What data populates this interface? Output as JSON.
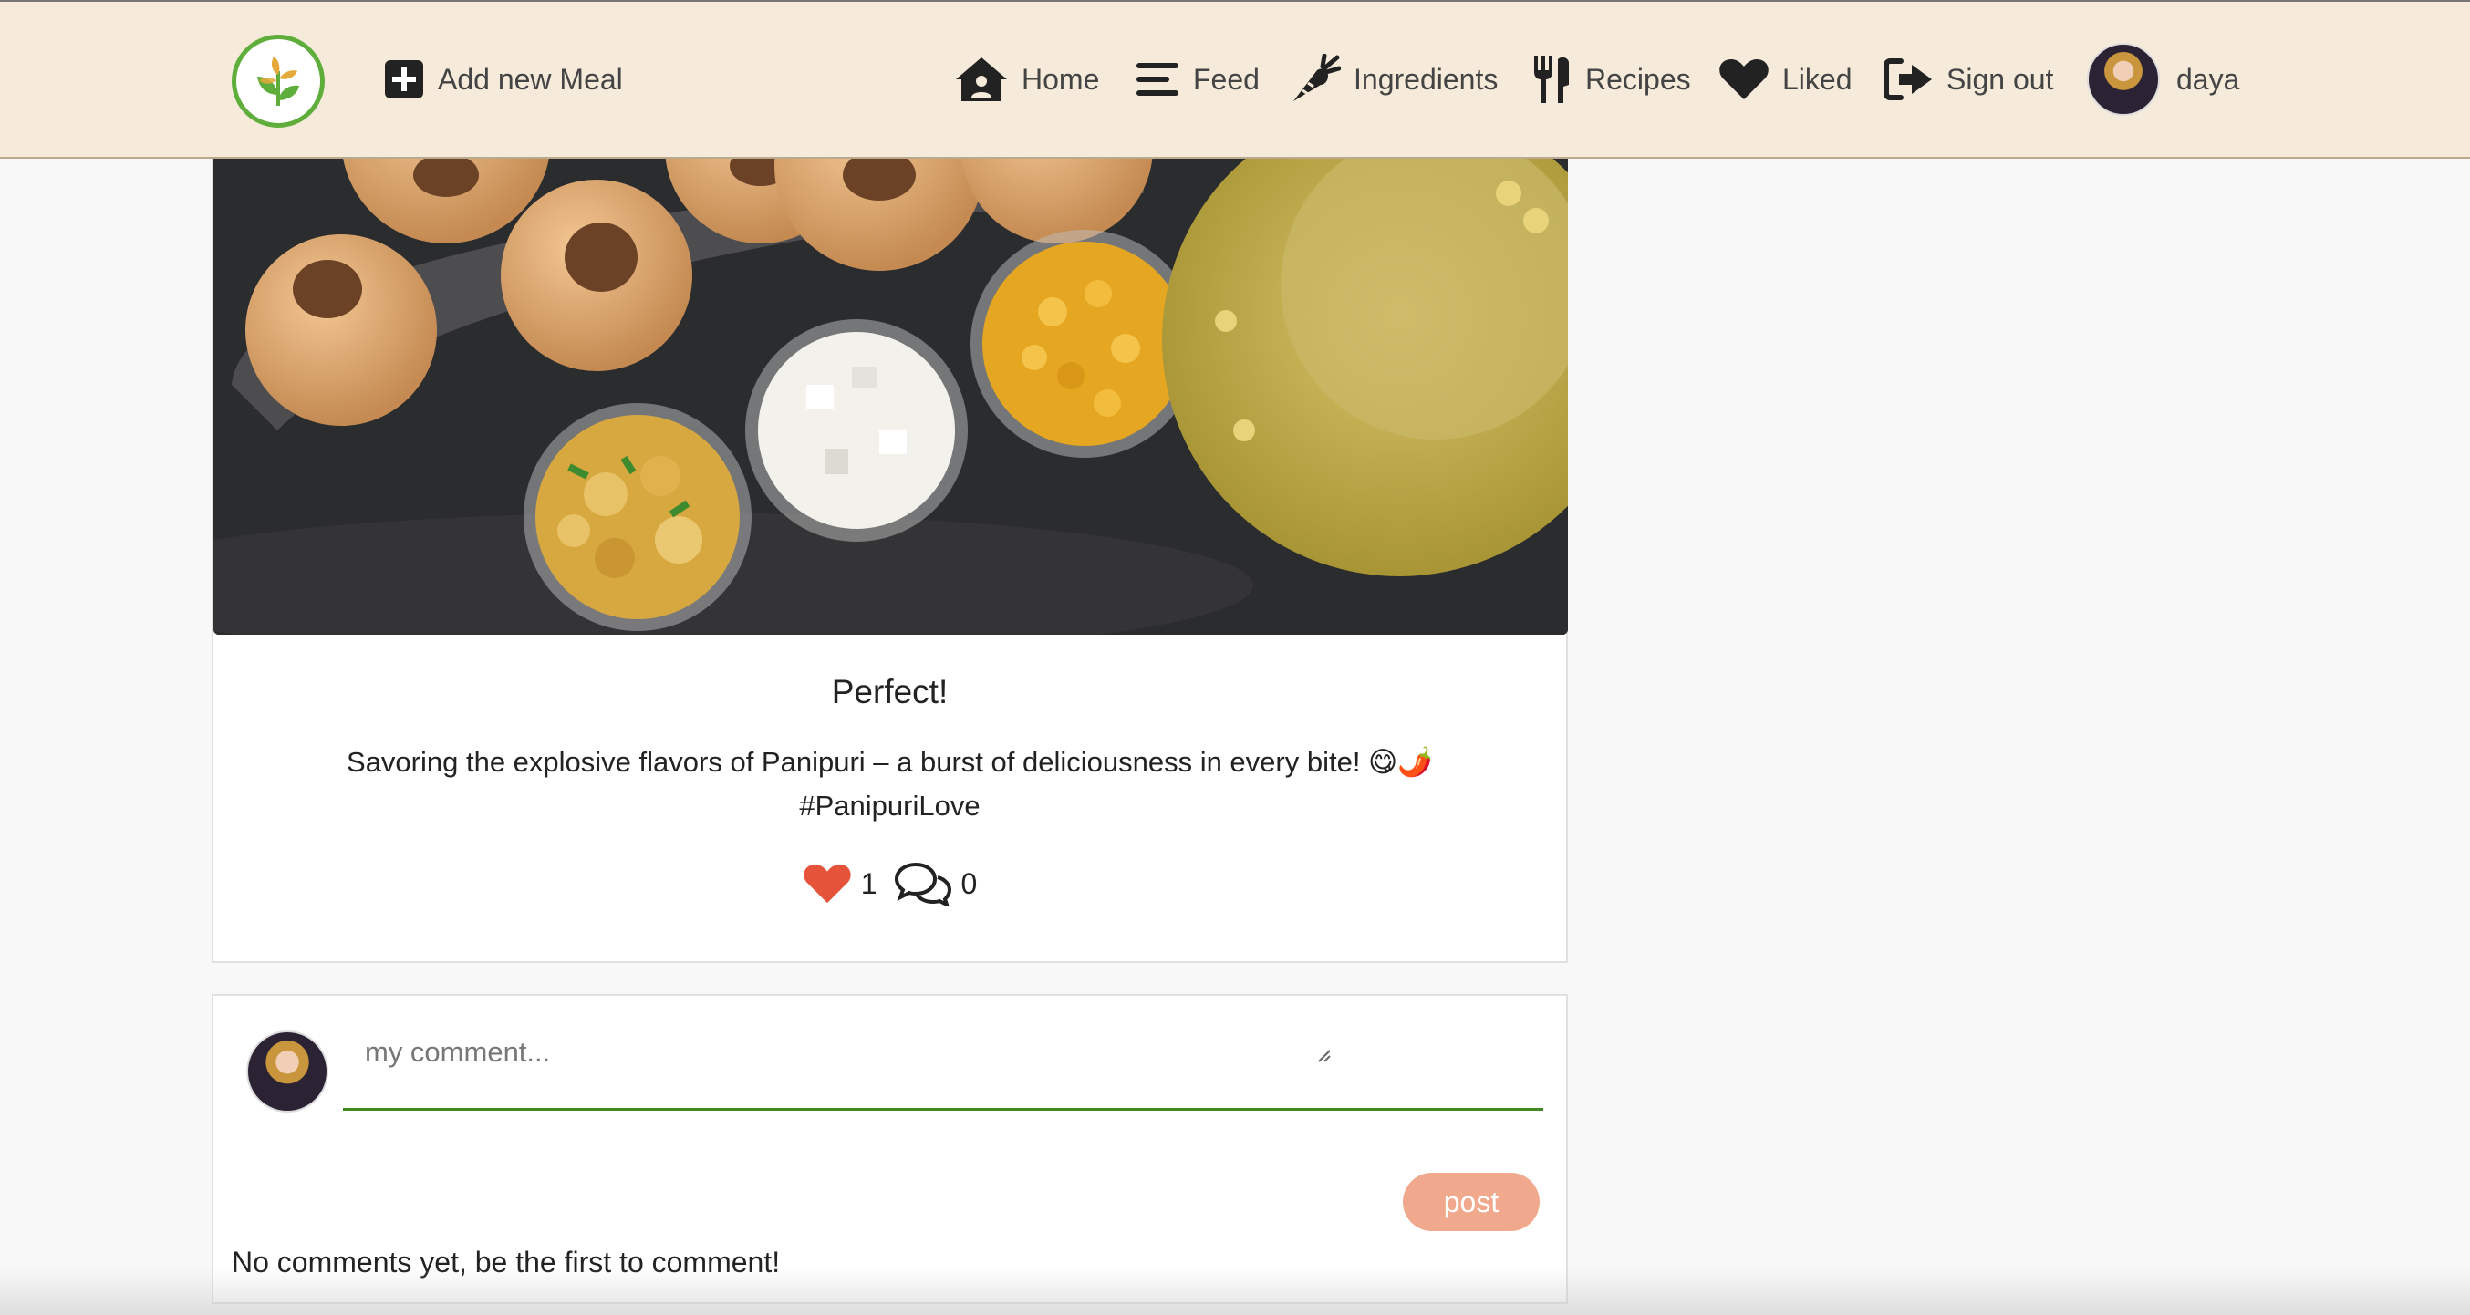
{
  "navbar": {
    "add_meal_label": "Add new Meal",
    "home_label": "Home",
    "feed_label": "Feed",
    "ingredients_label": "Ingredients",
    "recipes_label": "Recipes",
    "liked_label": "Liked",
    "signout_label": "Sign out",
    "username": "daya"
  },
  "post": {
    "title": "Perfect!",
    "description": "Savoring the explosive flavors of Panipuri – a burst of deliciousness in every bite! 😋🌶️",
    "hashtag": "#PanipuriLove",
    "likes": "1",
    "comments": "0"
  },
  "comment_box": {
    "placeholder": "my comment...",
    "post_label": "post",
    "empty_message": "No comments yet, be the first to comment!"
  },
  "colors": {
    "navbar_bg": "#f6ebda",
    "accent_green": "#3f8a25",
    "like_red": "#e5533a",
    "post_button": "#f0a98c"
  },
  "icons": {
    "logo": "sprout-logo-icon",
    "add": "plus-square-icon",
    "home": "home-icon",
    "feed": "bars-icon",
    "ingredients": "carrot-icon",
    "recipes": "utensils-icon",
    "liked": "heart-icon",
    "signout": "sign-out-icon",
    "comments": "comments-icon"
  }
}
